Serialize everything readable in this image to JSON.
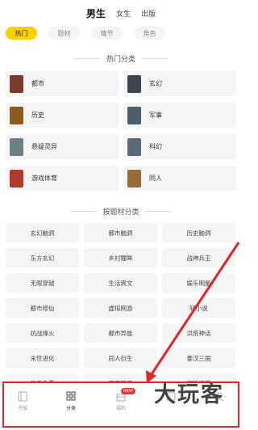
{
  "top_tabs": [
    {
      "label": "男生",
      "active": true
    },
    {
      "label": "女生",
      "active": false
    },
    {
      "label": "出版",
      "active": false
    }
  ],
  "filters": [
    {
      "label": "热门",
      "active": true
    },
    {
      "label": "题材",
      "active": false
    },
    {
      "label": "情节",
      "active": false
    },
    {
      "label": "角色",
      "active": false
    }
  ],
  "hot_section": {
    "title": "热门分类",
    "items": [
      {
        "label": "都市",
        "cover_color": "#7a3b2a"
      },
      {
        "label": "玄幻",
        "cover_color": "#3e4652"
      },
      {
        "label": "历史",
        "cover_color": "#8a5a1f"
      },
      {
        "label": "军事",
        "cover_color": "#4d5f6a"
      },
      {
        "label": "悬疑灵异",
        "cover_color": "#6f7f86"
      },
      {
        "label": "科幻",
        "cover_color": "#5a6a7a"
      },
      {
        "label": "游戏体育",
        "cover_color": "#b23a2a"
      },
      {
        "label": "同人",
        "cover_color": "#9a6b3a"
      }
    ]
  },
  "subject_section": {
    "title": "按题材分类",
    "items": [
      "玄幻脑洞",
      "都市脑洞",
      "历史脑洞",
      "东方玄幻",
      "乡村瞳眸",
      "战神兵王",
      "无限穿越",
      "生活爽文",
      "娱乐明星",
      "都市修仙",
      "虚拟网游",
      "轻小说",
      "抗战烽火",
      "都市异能",
      "洪荒神话",
      "末世进化",
      "同人衍生",
      "泰汉三国",
      "异界争霸",
      "两晋隋唐",
      "探险盗墓"
    ]
  },
  "bottom_nav": {
    "items": [
      {
        "label": "书城",
        "icon": "book-icon",
        "active": false
      },
      {
        "label": "分类",
        "icon": "grid-icon",
        "active": true
      },
      {
        "label": "福利",
        "icon": "gift-icon",
        "active": false,
        "badge": "NEW"
      },
      {
        "label": "",
        "icon": "bookshelf-icon",
        "active": false
      },
      {
        "label": "",
        "icon": "user-icon",
        "active": false
      }
    ]
  },
  "watermark": "大玩客",
  "colors": {
    "accent": "#ffd000",
    "annotation": "#e3242b",
    "card_bg": "#f5f5f5"
  }
}
